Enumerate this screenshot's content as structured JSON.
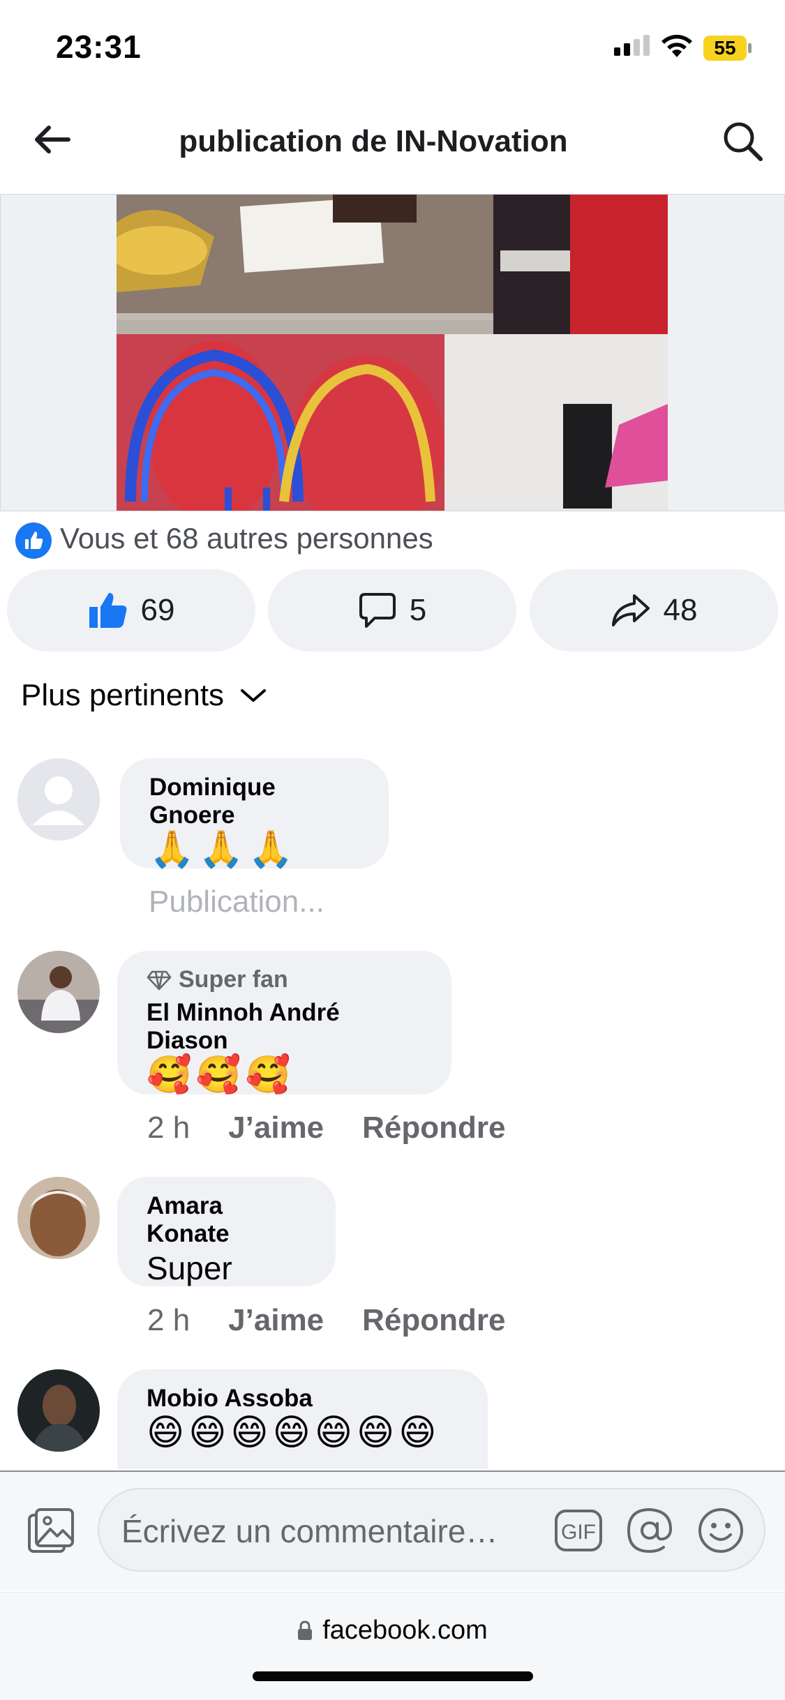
{
  "status_bar": {
    "time": "23:31",
    "battery": "55"
  },
  "nav": {
    "title": "publication de IN-Novation",
    "back_icon": "back-arrow-icon",
    "search_icon": "search-icon"
  },
  "post": {
    "reactions_text": "Vous et 68 autres personnes",
    "like_count": "69",
    "comment_count": "5",
    "share_count": "48"
  },
  "sort": {
    "label": "Plus pertinents"
  },
  "comments": [
    {
      "author": "Dominique Gnoere",
      "text": "🙏🙏🙏",
      "status": "Publication..."
    },
    {
      "badge": "Super fan",
      "author": "El Minnoh André Diason",
      "text": "🥰🥰🥰",
      "time": "2 h",
      "like": "J’aime",
      "reply": "Répondre"
    },
    {
      "author": "Amara Konate",
      "text": "Super",
      "time": "2 h",
      "like": "J’aime",
      "reply": "Répondre"
    },
    {
      "author": "Mobio Assoba",
      "text": "😄😄😄😄😄😄😄"
    }
  ],
  "composer": {
    "placeholder": "Écrivez un commentaire…",
    "gif_label": "GIF"
  },
  "browser": {
    "url": "facebook.com"
  },
  "colors": {
    "accent": "#1877f2",
    "pill_bg": "#eff1f5",
    "secondary_text": "#65676b"
  }
}
